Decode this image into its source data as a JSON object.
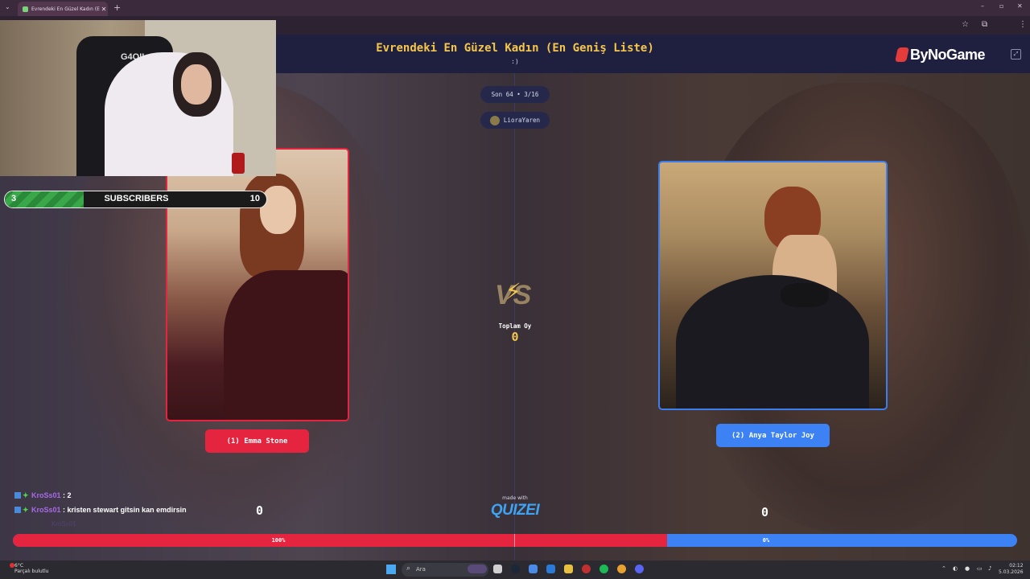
{
  "browser": {
    "tab_title": "Evrendeki En Güzel Kadın (En G",
    "tab_close": "✕",
    "new_tab": "+",
    "menu": "⌄",
    "controls": {
      "minimize": "–",
      "maximize": "▫",
      "close": "✕"
    }
  },
  "header": {
    "title": "Evrendeki En Güzel Kadın (En Geniş Liste)",
    "subtitle": ":)",
    "brand": "ByNoGame"
  },
  "round": {
    "pill": "Son 64 • 3/16",
    "user": "LioraYaren"
  },
  "left": {
    "name": "(1) Emma Stone",
    "votes": "0",
    "percent": "100%",
    "fraction": 1.0
  },
  "right": {
    "name": "(2) Anya Taylor Joy",
    "votes": "0",
    "percent": "0%"
  },
  "center": {
    "vs": "VS",
    "total_label": "Toplam Oy",
    "total_value": "0",
    "made_with": "made with",
    "logo": "QUIZEI"
  },
  "stream": {
    "chair_text": "G4OIL",
    "subs_current": "3",
    "subs_label": "SUBSCRIBERS",
    "subs_goal": "10",
    "subs_fraction": 0.3,
    "chat": [
      {
        "user": "KroSs01",
        "text": ": 2"
      },
      {
        "user": "KroSs01",
        "text": ": kristen stewart gitsin kan emdirsin"
      }
    ],
    "chat_faded": "KroSs01"
  },
  "taskbar": {
    "weather_temp": "6°C",
    "weather_desc": "Parçalı bulutlu",
    "search_placeholder": "Ara",
    "time": "02:12",
    "date": "5.03.2026"
  },
  "colors": {
    "left": "#e5243f",
    "right": "#3c82f5",
    "gold": "#f5c64a"
  }
}
